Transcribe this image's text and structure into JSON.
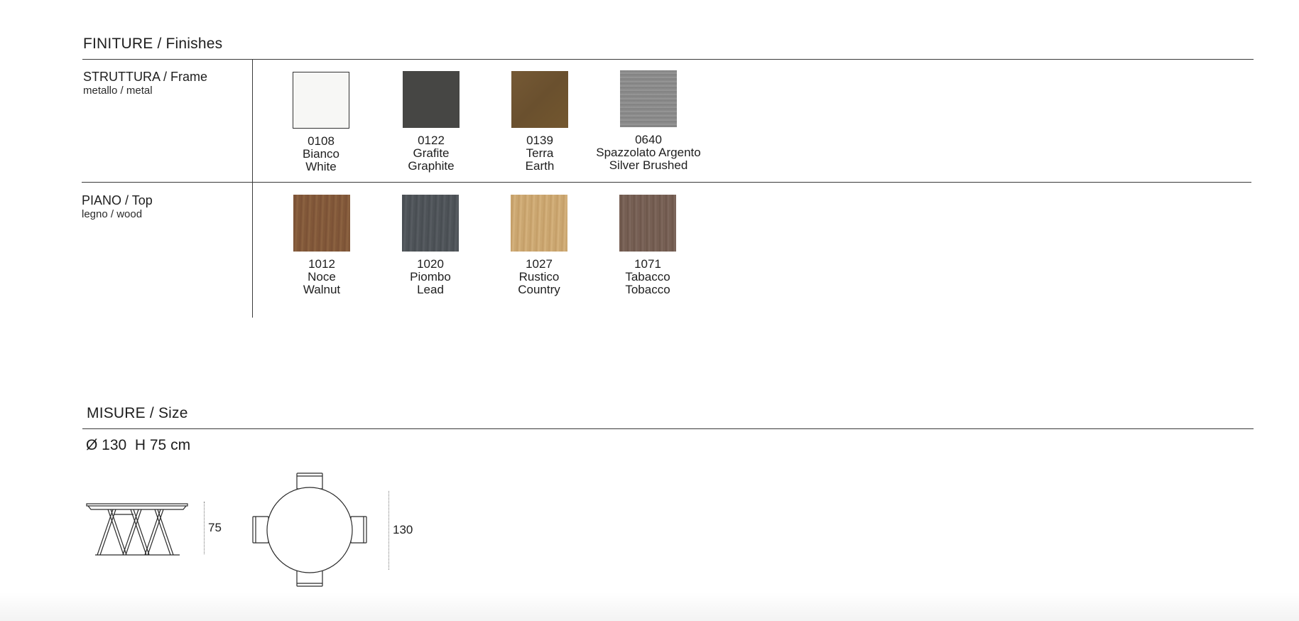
{
  "finishes": {
    "title": "FINITURE / Finishes",
    "rows": [
      {
        "label": "STRUTTURA / Frame",
        "sublabel": "metallo / metal",
        "swatches": [
          {
            "code": "0108",
            "name_it": "Bianco",
            "name_en": "White",
            "color": "#f7f7f5",
            "texture": "plain",
            "border": true
          },
          {
            "code": "0122",
            "name_it": "Grafite",
            "name_en": "Graphite",
            "color": "#464644",
            "texture": "plain"
          },
          {
            "code": "0139",
            "name_it": "Terra",
            "name_en": "Earth",
            "color": "#6e5431",
            "texture": "plain"
          },
          {
            "code": "0640",
            "name_it": "Spazzolato Argento",
            "name_en": "Silver Brushed",
            "color": "#8b8b8b",
            "texture": "brushed"
          }
        ]
      },
      {
        "label": "PIANO / Top",
        "sublabel": "legno / wood",
        "swatches": [
          {
            "code": "1012",
            "name_it": "Noce",
            "name_en": "Walnut",
            "color": "#80583a",
            "texture": "wood"
          },
          {
            "code": "1020",
            "name_it": "Piombo",
            "name_en": "Lead",
            "color": "#4f5459",
            "texture": "wood"
          },
          {
            "code": "1027",
            "name_it": "Rustico",
            "name_en": "Country",
            "color": "#c9a570",
            "texture": "wood"
          },
          {
            "code": "1071",
            "name_it": "Tabacco",
            "name_en": "Tobacco",
            "color": "#735d52",
            "texture": "wood"
          }
        ]
      }
    ]
  },
  "size": {
    "title": "MISURE / Size",
    "value": "Ø 130  H 75 cm",
    "side_view_height": "75",
    "top_view_diameter": "130",
    "side_view_icon": "table-side-view-icon",
    "top_view_icon": "table-top-view-icon"
  }
}
